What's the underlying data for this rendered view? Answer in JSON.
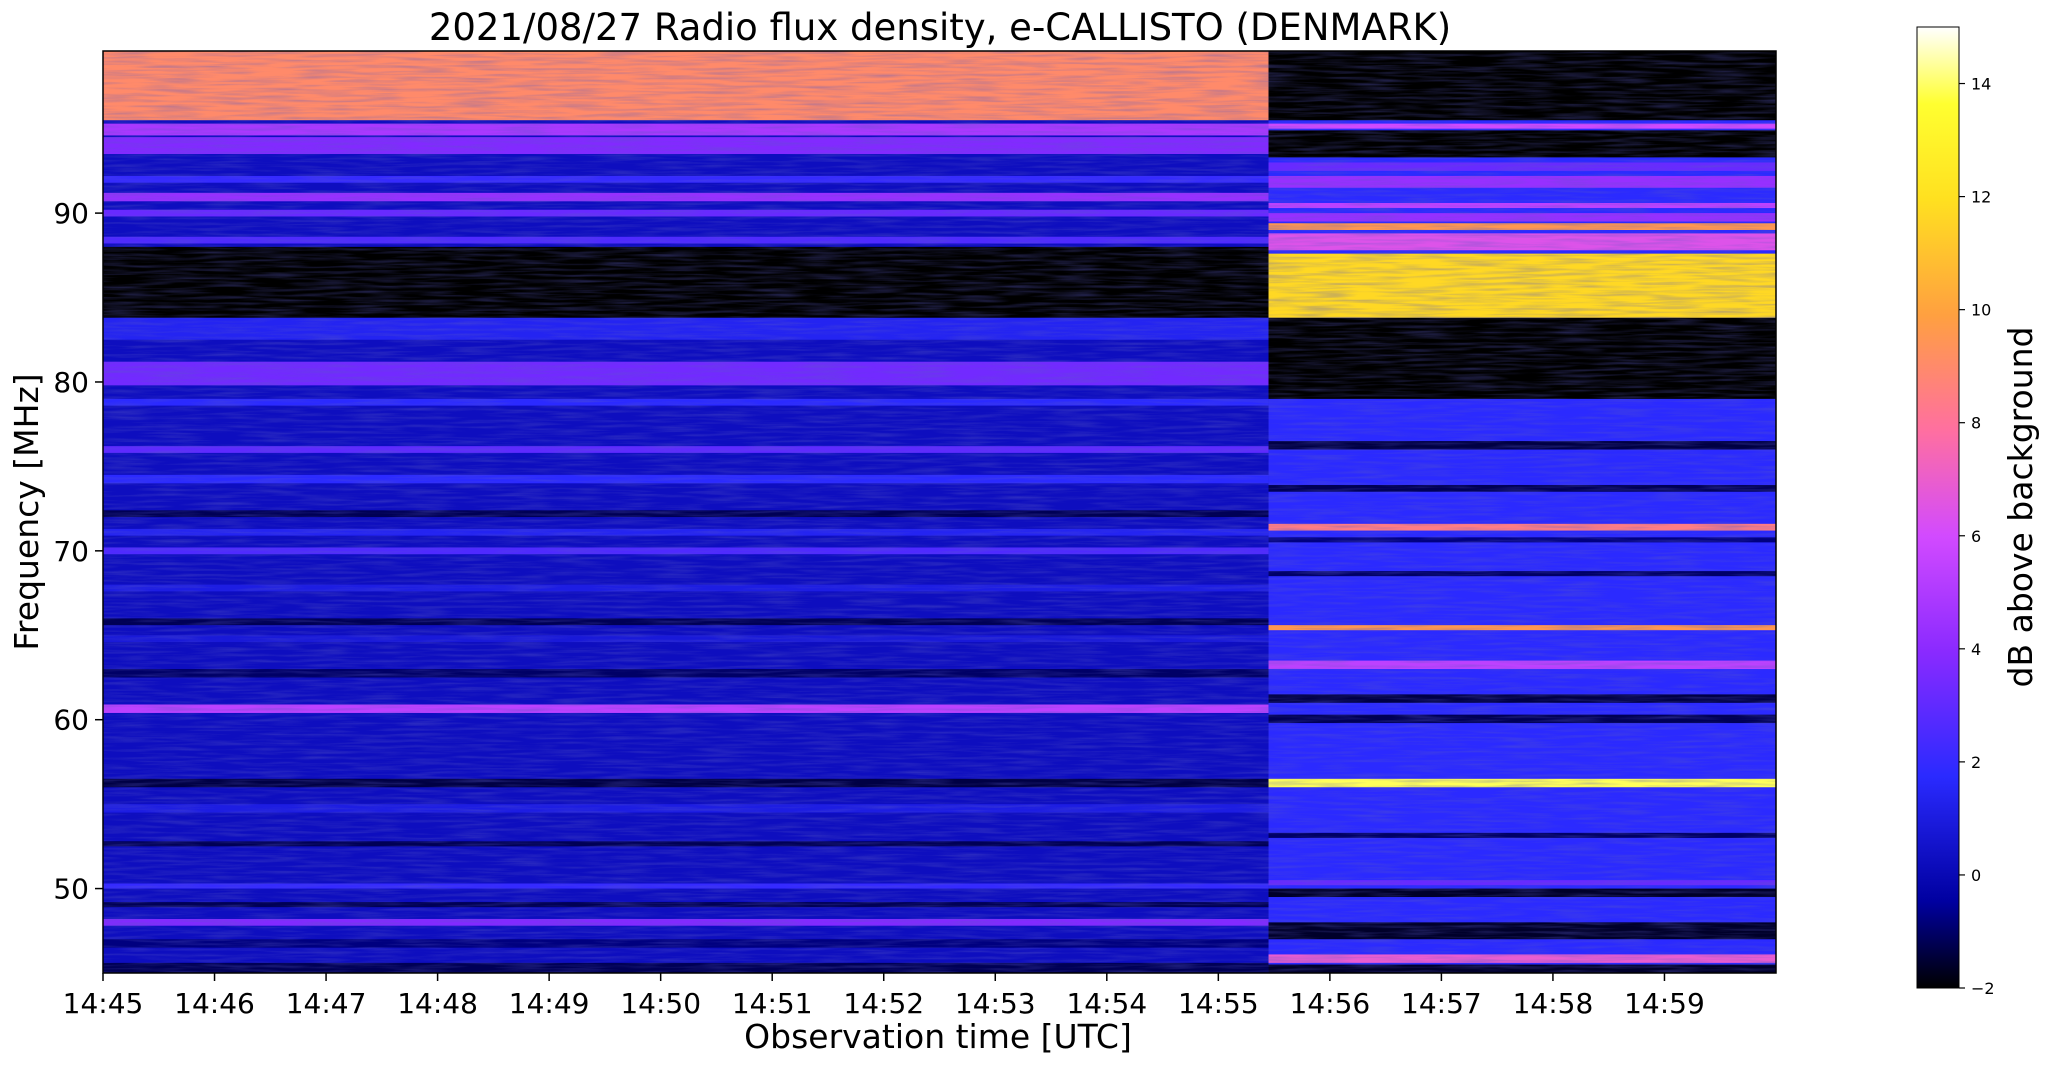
{
  "chart_data": {
    "type": "heatmap",
    "title": "2021/08/27  Radio flux density, e-CALLISTO (DENMARK)",
    "xlabel": "Observation time [UTC]",
    "ylabel": "Frequency [MHz]",
    "x_tick_labels": [
      "14:45",
      "14:46",
      "14:47",
      "14:48",
      "14:49",
      "14:50",
      "14:51",
      "14:52",
      "14:53",
      "14:54",
      "14:55",
      "14:56",
      "14:57",
      "14:58",
      "14:59"
    ],
    "y_tick_labels": [
      "50",
      "60",
      "70",
      "80",
      "90"
    ],
    "xlim": [
      "14:45:00",
      "15:00:00"
    ],
    "ylim": [
      45,
      99.6
    ],
    "colorbar": {
      "label": "dB above background",
      "range": [
        -2,
        15
      ],
      "ticks": [
        -2,
        0,
        2,
        4,
        6,
        8,
        10,
        12,
        14
      ],
      "colormap": "gnuplot2",
      "colors": [
        "#000000",
        "#0000a0",
        "#2a2aff",
        "#8a2aff",
        "#d24aff",
        "#ff6fa0",
        "#ffa040",
        "#ffe020",
        "#ffff30",
        "#ffffff"
      ]
    },
    "segments": [
      {
        "time_range": [
          "14:45:00",
          "14:55:27"
        ],
        "background_db": 0.5,
        "bands": [
          {
            "f": [
              95.5,
              99.6
            ],
            "db": 8.5
          },
          {
            "f": [
              94.6,
              95.3
            ],
            "db": 4.5
          },
          {
            "f": [
              93.5,
              94.5
            ],
            "db": 3.5
          },
          {
            "f": [
              91.8,
              92.2
            ],
            "db": 2.0
          },
          {
            "f": [
              90.7,
              91.2
            ],
            "db": 4.0
          },
          {
            "f": [
              89.8,
              90.2
            ],
            "db": 3.0
          },
          {
            "f": [
              88.2,
              88.6
            ],
            "db": 2.5
          },
          {
            "f": [
              83.8,
              88.0
            ],
            "db": -2.0
          },
          {
            "f": [
              82.5,
              83.8
            ],
            "db": 1.5
          },
          {
            "f": [
              79.8,
              81.2
            ],
            "db": 3.2
          },
          {
            "f": [
              78.6,
              79.0
            ],
            "db": 1.8
          },
          {
            "f": [
              75.8,
              76.2
            ],
            "db": 2.8
          },
          {
            "f": [
              74.0,
              74.5
            ],
            "db": 1.8
          },
          {
            "f": [
              72.0,
              72.4
            ],
            "db": -1.0
          },
          {
            "f": [
              70.9,
              71.3
            ],
            "db": 1.5
          },
          {
            "f": [
              69.8,
              70.2
            ],
            "db": 2.5
          },
          {
            "f": [
              67.6,
              68.0
            ],
            "db": 1.2
          },
          {
            "f": [
              65.6,
              66.0
            ],
            "db": -1.0
          },
          {
            "f": [
              64.6,
              65.0
            ],
            "db": 1.0
          },
          {
            "f": [
              62.5,
              63.0
            ],
            "db": -0.8
          },
          {
            "f": [
              60.4,
              60.9
            ],
            "db": 5.0
          },
          {
            "f": [
              56.0,
              56.5
            ],
            "db": -1.2
          },
          {
            "f": [
              54.5,
              55.0
            ],
            "db": 1.2
          },
          {
            "f": [
              52.5,
              52.8
            ],
            "db": -1.0
          },
          {
            "f": [
              50.0,
              50.3
            ],
            "db": 2.0
          },
          {
            "f": [
              48.9,
              49.2
            ],
            "db": -1.0
          },
          {
            "f": [
              47.8,
              48.2
            ],
            "db": 3.5
          },
          {
            "f": [
              46.5,
              47.0
            ],
            "db": -0.5
          },
          {
            "f": [
              45.0,
              45.6
            ],
            "db": -1.0
          }
        ]
      },
      {
        "time_range": [
          "14:55:27",
          "15:00:00"
        ],
        "background_db": 1.8,
        "bands": [
          {
            "f": [
              95.5,
              99.6
            ],
            "db": -2.0
          },
          {
            "f": [
              95.0,
              95.3
            ],
            "db": 5.5
          },
          {
            "f": [
              93.3,
              94.9
            ],
            "db": -2.0
          },
          {
            "f": [
              92.5,
              93.0
            ],
            "db": 3.0
          },
          {
            "f": [
              91.5,
              92.2
            ],
            "db": 4.0
          },
          {
            "f": [
              90.3,
              90.6
            ],
            "db": 5.0
          },
          {
            "f": [
              89.5,
              90.0
            ],
            "db": 4.0
          },
          {
            "f": [
              89.0,
              89.4
            ],
            "db": 9.0
          },
          {
            "f": [
              87.8,
              88.8
            ],
            "db": 6.0
          },
          {
            "f": [
              83.8,
              87.6
            ],
            "db": 11.0
          },
          {
            "f": [
              79.0,
              83.8
            ],
            "db": -2.0
          },
          {
            "f": [
              76.0,
              76.5
            ],
            "db": -1.2
          },
          {
            "f": [
              73.5,
              73.9
            ],
            "db": -1.0
          },
          {
            "f": [
              71.2,
              71.6
            ],
            "db": 8.0
          },
          {
            "f": [
              70.5,
              70.8
            ],
            "db": -0.5
          },
          {
            "f": [
              68.5,
              68.8
            ],
            "db": -0.8
          },
          {
            "f": [
              65.3,
              65.6
            ],
            "db": 9.0
          },
          {
            "f": [
              63.0,
              63.5
            ],
            "db": 5.0
          },
          {
            "f": [
              61.0,
              61.5
            ],
            "db": -1.2
          },
          {
            "f": [
              59.8,
              60.3
            ],
            "db": -1.0
          },
          {
            "f": [
              56.0,
              56.5
            ],
            "db": 13.5
          },
          {
            "f": [
              53.0,
              53.3
            ],
            "db": -0.8
          },
          {
            "f": [
              50.2,
              50.5
            ],
            "db": 3.0
          },
          {
            "f": [
              49.5,
              50.0
            ],
            "db": -1.5
          },
          {
            "f": [
              47.0,
              48.0
            ],
            "db": -1.5
          },
          {
            "f": [
              45.6,
              46.1
            ],
            "db": 6.5
          },
          {
            "f": [
              45.0,
              45.5
            ],
            "db": -1.5
          }
        ]
      }
    ]
  }
}
